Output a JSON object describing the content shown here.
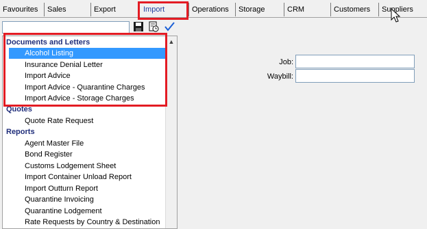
{
  "tabs": [
    {
      "label": "Favourites",
      "active": false
    },
    {
      "label": "Sales",
      "active": false
    },
    {
      "label": "Export",
      "active": false
    },
    {
      "label": "Import",
      "active": true
    },
    {
      "label": "Operations",
      "active": false
    },
    {
      "label": "Storage",
      "active": false
    },
    {
      "label": "CRM",
      "active": false
    },
    {
      "label": "Customers",
      "active": false
    },
    {
      "label": "Suppliers",
      "active": false
    }
  ],
  "toolbar": {
    "search_value": "",
    "save_icon": "save-icon",
    "history_icon": "history-icon",
    "check_icon": "check-icon"
  },
  "tree": {
    "groups": [
      {
        "label": "Documents and Letters",
        "items": [
          {
            "label": "Alcohol Listing",
            "selected": true
          },
          {
            "label": "Insurance Denial Letter",
            "selected": false
          },
          {
            "label": "Import Advice",
            "selected": false
          },
          {
            "label": "Import Advice - Quarantine Charges",
            "selected": false
          },
          {
            "label": "Import Advice - Storage Charges",
            "selected": false
          }
        ]
      },
      {
        "label": "Quotes",
        "items": [
          {
            "label": "Quote Rate Request",
            "selected": false
          }
        ]
      },
      {
        "label": "Reports",
        "items": [
          {
            "label": "Agent Master File",
            "selected": false
          },
          {
            "label": "Bond Register",
            "selected": false
          },
          {
            "label": "Customs Lodgement Sheet",
            "selected": false
          },
          {
            "label": "Import Container Unload Report",
            "selected": false
          },
          {
            "label": "Import Outturn Report",
            "selected": false
          },
          {
            "label": "Quarantine Invoicing",
            "selected": false
          },
          {
            "label": "Quarantine Lodgement",
            "selected": false
          },
          {
            "label": "Rate Requests by Country & Destination",
            "selected": false
          }
        ]
      }
    ]
  },
  "form": {
    "job_label": "Job:",
    "job_value": "",
    "waybill_label": "Waybill:",
    "waybill_value": ""
  },
  "colors": {
    "highlight": "#e31b23",
    "selection": "#3399ff",
    "group_text": "#1f2d7a"
  }
}
